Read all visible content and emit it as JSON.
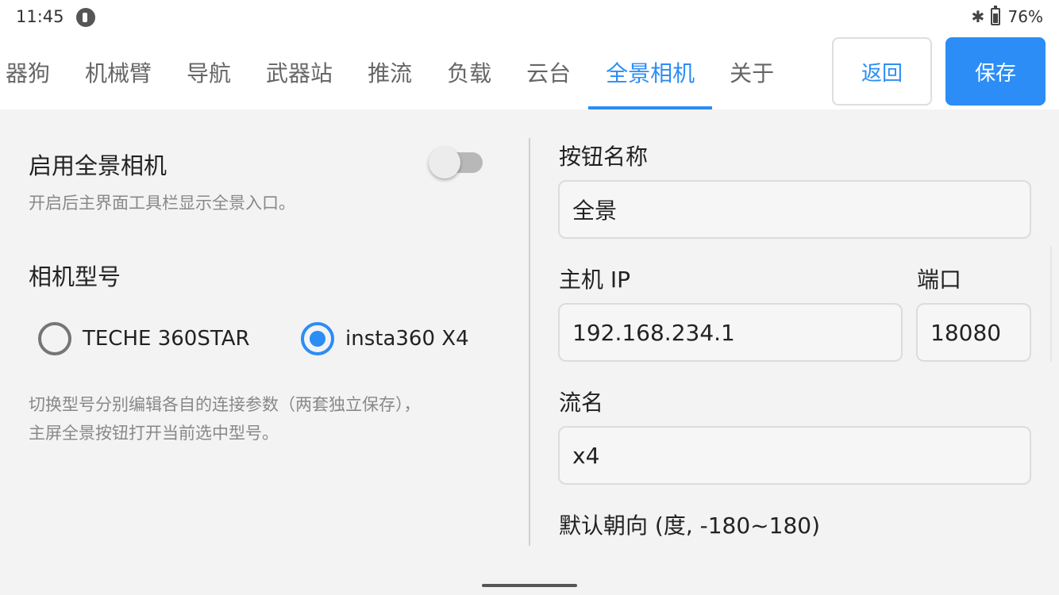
{
  "status": {
    "time": "11:45",
    "battery": "76%"
  },
  "tabs": [
    {
      "label": "器狗",
      "active": false
    },
    {
      "label": "机械臂",
      "active": false
    },
    {
      "label": "导航",
      "active": false
    },
    {
      "label": "武器站",
      "active": false
    },
    {
      "label": "推流",
      "active": false
    },
    {
      "label": "负载",
      "active": false
    },
    {
      "label": "云台",
      "active": false
    },
    {
      "label": "全景相机",
      "active": true
    },
    {
      "label": "关于",
      "active": false
    }
  ],
  "actions": {
    "back_label": "返回",
    "save_label": "保存"
  },
  "colors": {
    "accent": "#2b8df5",
    "panel_bg": "#f3f3f3"
  },
  "left": {
    "enable_label": "启用全景相机",
    "enable_hint": "开启后主界面工具栏显示全景入口。",
    "enable_on": false,
    "model_label": "相机型号",
    "options": [
      {
        "label": "TECHE 360STAR",
        "checked": false
      },
      {
        "label": "insta360 X4",
        "checked": true
      }
    ],
    "switch_hint_line1": "切换型号分别编辑各自的连接参数（两套独立保存），",
    "switch_hint_line2": "主屏全景按钮打开当前选中型号。"
  },
  "right": {
    "button_name_label": "按钮名称",
    "button_name_value": "全景",
    "host_ip_label": "主机 IP",
    "host_ip_value": "192.168.234.1",
    "port_label": "端口",
    "port_value": "18080",
    "stream_name_label": "流名",
    "stream_name_value": "x4",
    "default_heading_label": "默认朝向 (度, -180~180)"
  }
}
